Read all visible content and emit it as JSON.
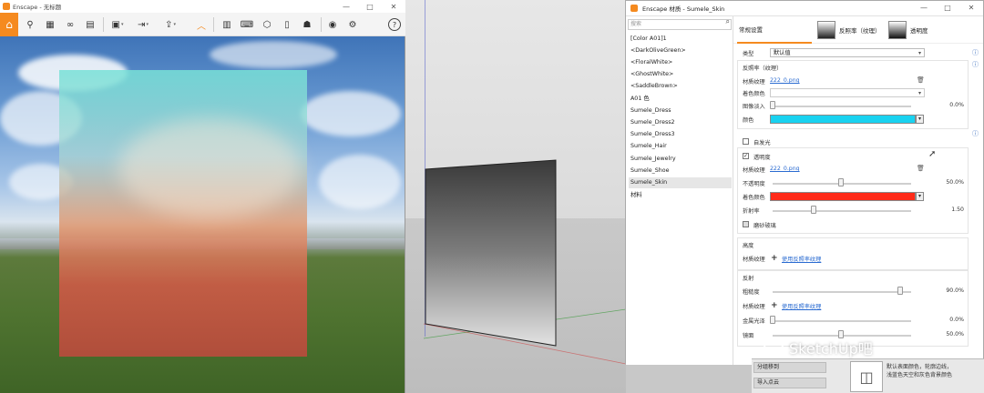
{
  "enscape_window": {
    "title": "Enscape - 无标题",
    "window_controls": [
      "—",
      "□",
      "✕"
    ]
  },
  "sketchup_strip": {
    "button_1": "分组移到",
    "button_2": "导入点云",
    "caption": "默认表面颜色，轮廓边线，\n浅蓝色天空和灰色背景颜色"
  },
  "material_window": {
    "title": "Enscape 材质 - Sumele_Skin",
    "window_controls": [
      "—",
      "□",
      "✕"
    ],
    "search_placeholder": "搜索",
    "materials": [
      "[Color A01]1",
      "<DarkOliveGreen>",
      "<FloralWhite>",
      "<GhostWhite>",
      "<SaddleBrown>",
      "A01 色",
      "Sumele_Dress",
      "Sumele_Dress2",
      "Sumele_Dress3",
      "Sumele_Hair",
      "Sumele_Jewelry",
      "Sumele_Shoe",
      "Sumele_Skin",
      "材料"
    ],
    "selected_material": "Sumele_Skin",
    "tabs": {
      "general": "常规设置",
      "reflection": "反照率（纹理）",
      "transparency": "透明度"
    },
    "type_label": "类型",
    "type_value": "默认值",
    "albedo": {
      "header": "反照率（纹理）",
      "texture_label": "材质纹理",
      "texture_link": "222_0.png",
      "tint_label": "着色颜色",
      "fade_label": "图像淡入",
      "fade_value": "0.0%",
      "color_label": "颜色",
      "color_hex": "#19d2f0"
    },
    "self_illum_label": "自发光",
    "transparency": {
      "label": "透明度",
      "texture_label": "材质纹理",
      "texture_link": "222_0.png",
      "opacity_label": "不透明度",
      "opacity_value": "50.0%",
      "tint_label": "着色颜色",
      "tint_hex": "#ff2a18",
      "ior_label": "折射率",
      "ior_value": "1.50",
      "frosted_label": "磨砂玻璃"
    },
    "height": {
      "header": "高度",
      "texture_label": "材质纹理",
      "link": "使用反照率纹理"
    },
    "reflection": {
      "header": "反射",
      "roughness_label": "粗糙度",
      "roughness_value": "90.0%",
      "texture_label": "材质纹理",
      "link": "使用反照率纹理",
      "metallic_label": "金属光泽",
      "metallic_value": "0.0%",
      "specular_label": "镜面",
      "specular_value": "50.0%"
    }
  },
  "watermark": {
    "wechat_label": "SketchUp吧"
  },
  "colors": {
    "accent_orange": "#f58a1f",
    "link_blue": "#2a6bd1"
  }
}
